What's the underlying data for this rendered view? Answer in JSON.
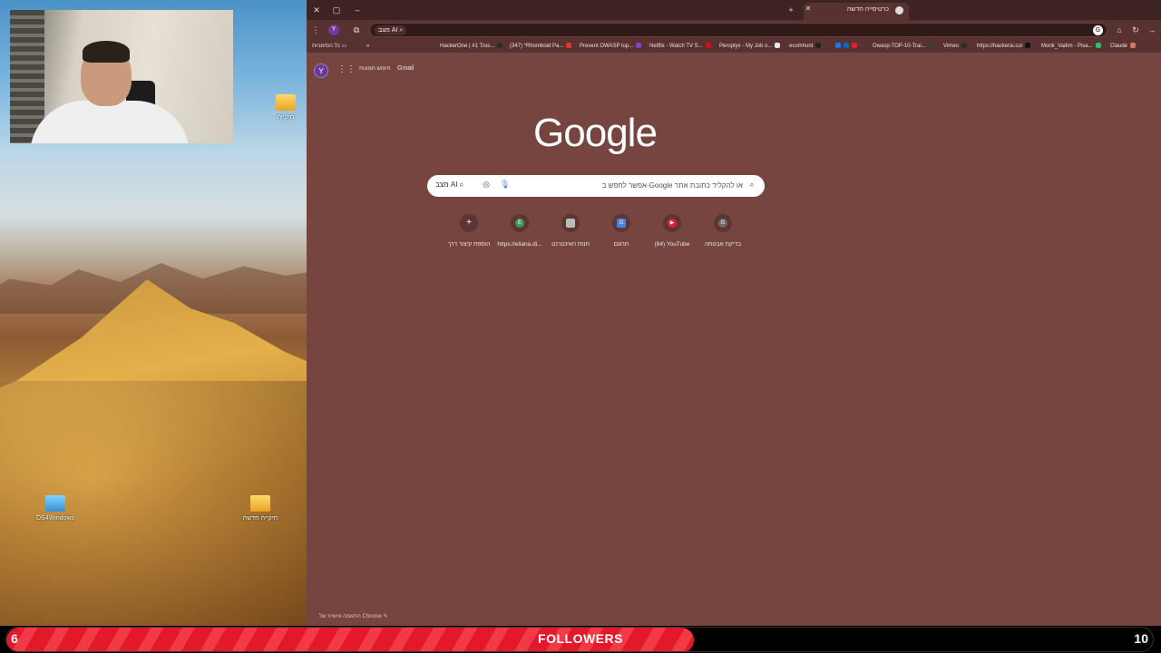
{
  "desktop": {
    "icons": [
      {
        "label": "DS4Windows",
        "icon": "app-icon"
      },
      {
        "label": "תיקייה חדשה",
        "icon": "folder-icon"
      },
      {
        "label": "תיקייה",
        "icon": "folder-icon"
      }
    ]
  },
  "browser": {
    "tab": {
      "title": "כרטיסייה חדשה"
    },
    "toolbar": {
      "profile": "Y",
      "omnibox_chip": "מצב AI",
      "omnibox_badge": "G"
    },
    "bookmarks": {
      "all_bookmarks": "כל הסימניות",
      "items": [
        {
          "label": "HackerOne | #1 Trus...",
          "color": "#2a2a2a"
        },
        {
          "label": "(347) *Rhomboid Pa...",
          "color": "#e0352b"
        },
        {
          "label": "Prevent OWASP top...",
          "color": "#8a3bd6"
        },
        {
          "label": "Netflix - Watch TV S...",
          "color": "#c7161f"
        },
        {
          "label": "Peroptyx - My Job o...",
          "color": "#e7e7e7"
        },
        {
          "label": "ecomhunt",
          "color": "#222222"
        },
        {
          "label": "Owasp-TOP-10-Trai...",
          "color": "#3b3b3b"
        },
        {
          "label": "Vimeo",
          "color": "#2b2b2b"
        },
        {
          "label": "https://hackerai.co/",
          "color": "#111111"
        },
        {
          "label": "Monk_Vadim - Pixa...",
          "color": "#2fbf71"
        },
        {
          "label": "Claude",
          "color": "#d97757"
        }
      ]
    },
    "newtab": {
      "account_initial": "Y",
      "images_link": "חיפוש תמונות",
      "gmail_link": "Gmail",
      "logo": "Google",
      "search_placeholder": "אפשר לחפש ב-Google או להקליד כתובת אתר",
      "ai_mode": "מצב AI",
      "shortcuts": [
        {
          "name": "בדיקת אבטחה",
          "letter": "G",
          "color": "#6b6b6b"
        },
        {
          "name": "(84) YouTube",
          "letter": "▶",
          "color": "#e0202a"
        },
        {
          "name": "תרגום",
          "letter": "G",
          "color": "#4a7fe6"
        },
        {
          "name": "חנות האינטרנט",
          "letter": "",
          "color": "#bbbbbb"
        },
        {
          "name": "https://eliana.di...",
          "letter": "E",
          "color": "#3f9a5a"
        },
        {
          "name": "הוספת קיצור דרך",
          "letter": "+",
          "color": "#5d3533"
        }
      ],
      "customize_label": "התאמה אישית של Chrome"
    }
  },
  "followers": {
    "label": "FOLLOWERS",
    "current": "6",
    "goal": "10",
    "progress": 0.6
  }
}
